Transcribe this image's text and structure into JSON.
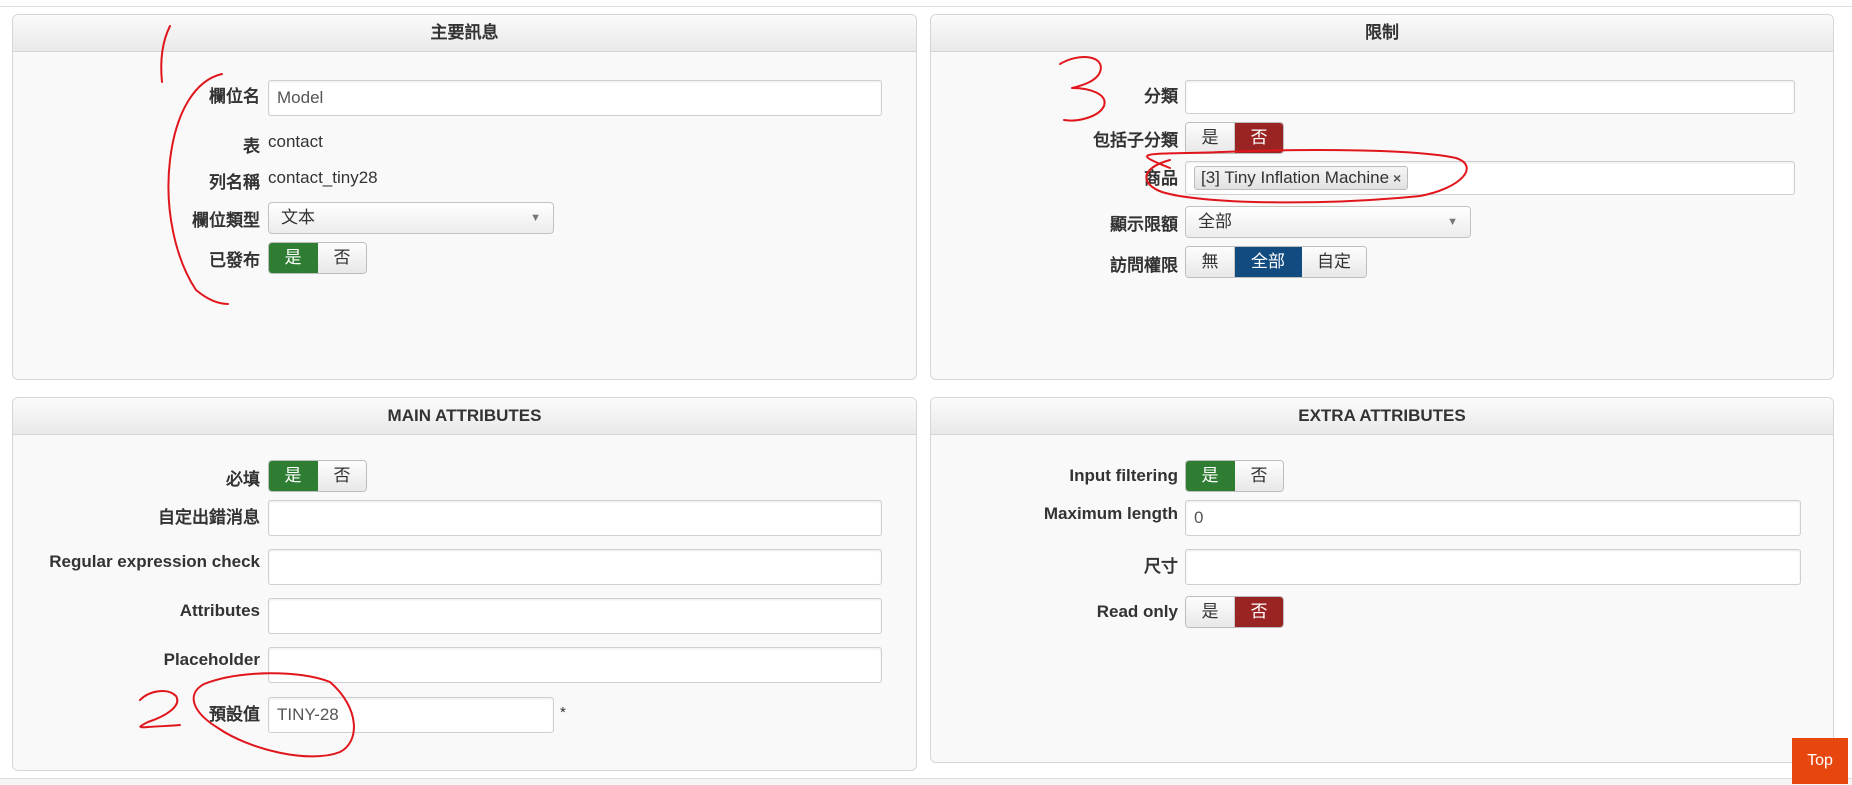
{
  "panels": {
    "main_info": {
      "title": "主要訊息",
      "field_name_label": "欄位名",
      "field_name_value": "Model",
      "table_label": "表",
      "table_value": "contact",
      "column_label": "列名稱",
      "column_value": "contact_tiny28",
      "field_type_label": "欄位類型",
      "field_type_value": "文本",
      "published_label": "已發布",
      "published_options": [
        "是",
        "否"
      ],
      "published_selected": "是"
    },
    "restrictions": {
      "title": "限制",
      "category_label": "分類",
      "category_value": "",
      "include_sub_label": "包括子分類",
      "include_sub_options": [
        "是",
        "否"
      ],
      "include_sub_selected": "否",
      "product_label": "商品",
      "product_tag": "[3] Tiny Inflation Machine",
      "product_tag_remove": "×",
      "display_limit_label": "顯示限額",
      "display_limit_value": "全部",
      "access_label": "訪問權限",
      "access_options": [
        "無",
        "全部",
        "自定"
      ],
      "access_selected": "全部"
    },
    "main_attributes": {
      "title": "MAIN ATTRIBUTES",
      "required_label": "必填",
      "required_options": [
        "是",
        "否"
      ],
      "required_selected": "是",
      "custom_error_label": "自定出錯消息",
      "custom_error_value": "",
      "regex_label": "Regular expression check",
      "regex_value": "",
      "attributes_label": "Attributes",
      "attributes_value": "",
      "placeholder_label": "Placeholder",
      "placeholder_value": "",
      "default_label": "預設值",
      "default_value": "TINY-28",
      "default_required_mark": "*"
    },
    "extra_attributes": {
      "title": "EXTRA ATTRIBUTES",
      "input_filtering_label": "Input filtering",
      "input_filtering_options": [
        "是",
        "否"
      ],
      "input_filtering_selected": "是",
      "max_length_label": "Maximum length",
      "max_length_value": "0",
      "size_label": "尺寸",
      "size_value": "",
      "read_only_label": "Read only",
      "read_only_options": [
        "是",
        "否"
      ],
      "read_only_selected": "否"
    }
  },
  "top_button_label": "Top",
  "annotations": {
    "color": "#e0161c",
    "mark_1": "1",
    "mark_2": "2",
    "mark_3": "3"
  }
}
